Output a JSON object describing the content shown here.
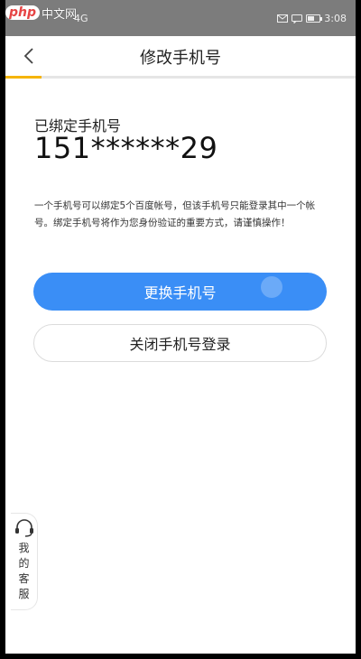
{
  "watermark": {
    "php": "php",
    "cn": "中文网"
  },
  "statusbar": {
    "signal": "4G",
    "time": "3:08"
  },
  "navbar": {
    "title": "修改手机号"
  },
  "content": {
    "label": "已绑定手机号",
    "phone": "151******29",
    "description": "一个手机号可以绑定5个百度帐号，但该手机号只能登录其中一个帐号。绑定手机号将作为您身份验证的重要方式，请谨慎操作！"
  },
  "actions": {
    "change": "更换手机号",
    "close_login": "关闭手机号登录"
  },
  "service": {
    "label": "我的客服"
  },
  "colors": {
    "primary": "#3a8ef6",
    "accent": "#f5b400"
  }
}
